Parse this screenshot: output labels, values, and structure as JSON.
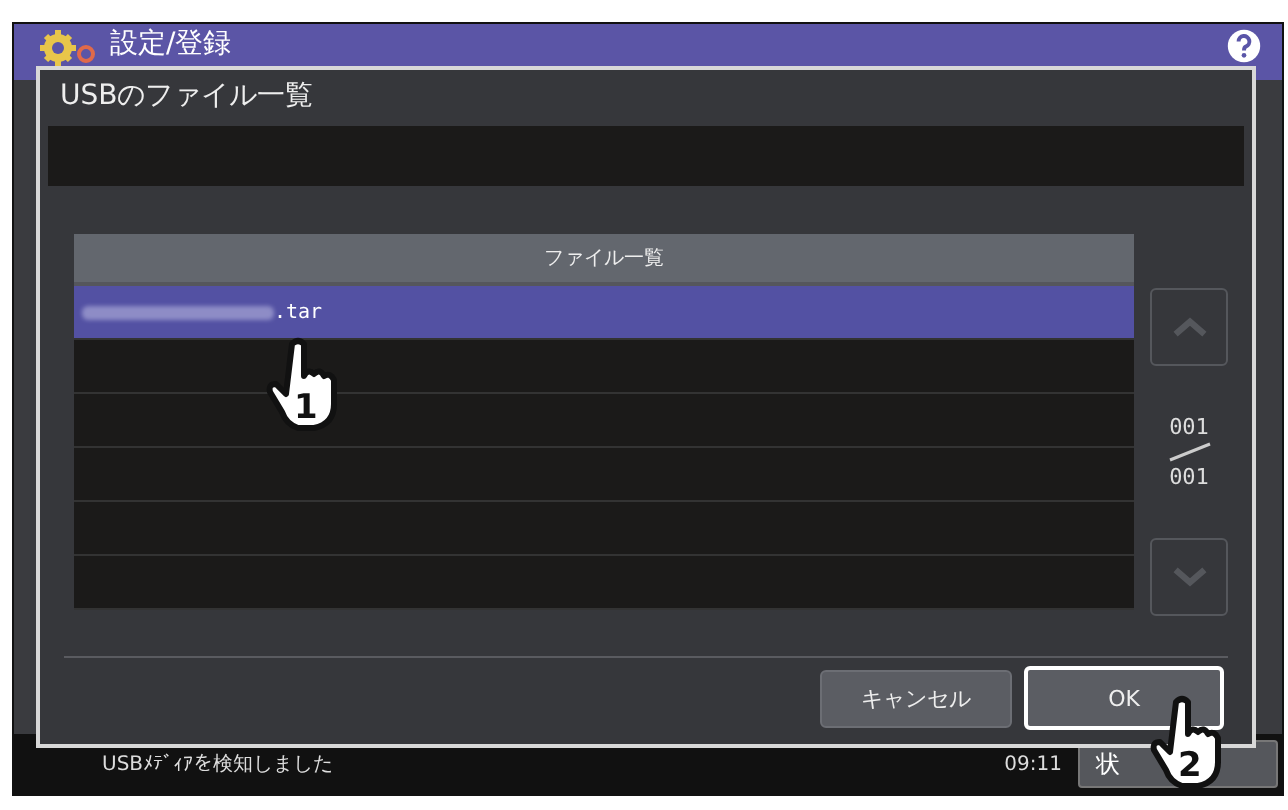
{
  "header": {
    "title": "設定/登録"
  },
  "dialog": {
    "title": "USBのファイル一覧",
    "table": {
      "columns": [
        "ファイル一覧"
      ],
      "rows": [
        {
          "name": ".tar",
          "selected": true
        },
        {
          "selected": false
        },
        {
          "selected": false
        },
        {
          "selected": false
        },
        {
          "selected": false
        },
        {
          "selected": false
        }
      ]
    },
    "page": {
      "current": "001",
      "total": "001"
    },
    "buttons": [
      {
        "label": "キャンセル",
        "kind": "normal"
      },
      {
        "label": "OK",
        "kind": "focused"
      }
    ]
  },
  "callouts": [
    "1",
    "2"
  ],
  "status_bar": {
    "message": "USBﾒﾃﾞｨｱを検知しました",
    "time": "09:11",
    "button": "状"
  }
}
